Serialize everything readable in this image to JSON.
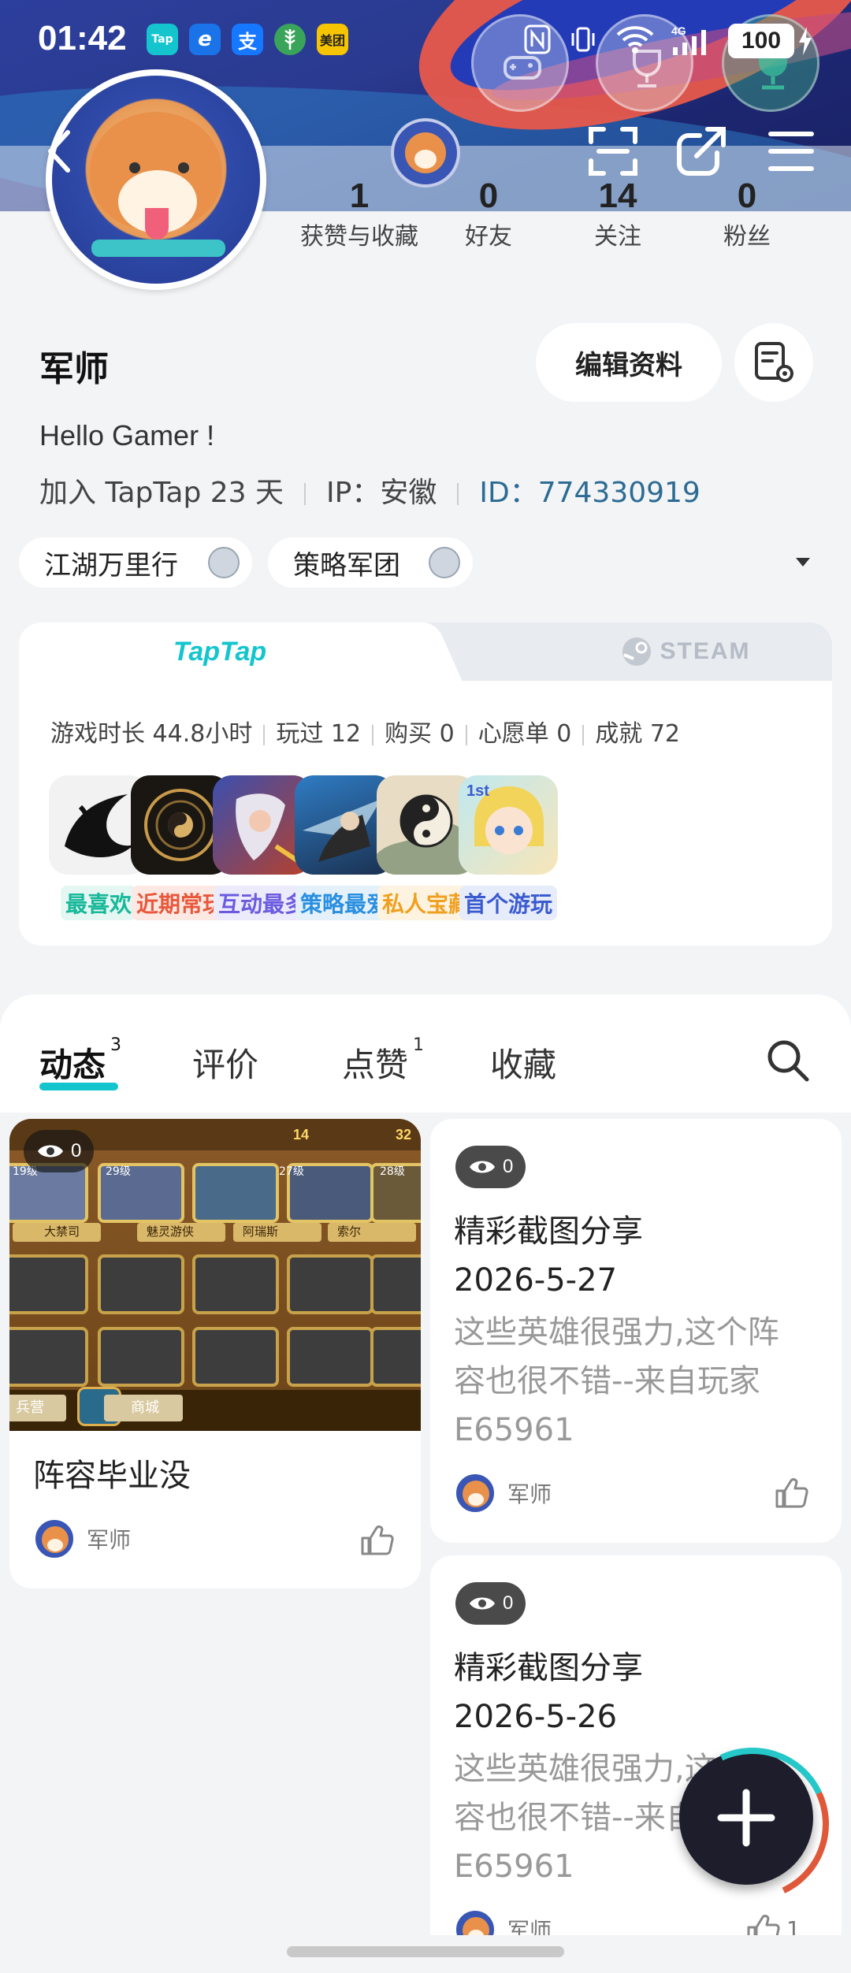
{
  "status_bar": {
    "time": "01:42",
    "apps": [
      {
        "name": "taptap-icon",
        "text": "Tap",
        "color": "#15c5ce"
      },
      {
        "name": "browser-icon",
        "text": "e",
        "color": "#1a73e8"
      },
      {
        "name": "alipay-icon",
        "text": "支",
        "color": "#1677ff"
      },
      {
        "name": "wheat-icon",
        "text": "",
        "color": "#3aa55a"
      },
      {
        "name": "meituan-icon",
        "text": "美团",
        "color": "#f7c400"
      }
    ],
    "battery": "100"
  },
  "profile": {
    "name": "军师",
    "edit_button": "编辑资料",
    "bio": "Hello Gamer !",
    "joined": "加入 TapTap 23 天",
    "ip": "IP：安徽",
    "id": "ID：774330919",
    "stats": [
      {
        "value": "1",
        "label": "获赞与收藏"
      },
      {
        "value": "0",
        "label": "好友"
      },
      {
        "value": "14",
        "label": "关注"
      },
      {
        "value": "0",
        "label": "粉丝"
      }
    ],
    "tags": [
      "江湖万里行",
      "策略军团"
    ]
  },
  "game_card": {
    "tabs": [
      "TapTap",
      "STEAM"
    ],
    "stats": [
      "游戏时长 44.8小时",
      "玩过 12",
      "购买 0",
      "心愿单 0",
      "成就 72"
    ],
    "games": [
      {
        "label": "最喜欢",
        "label_color": "#18b89a",
        "label_bg": "#e4f7f2"
      },
      {
        "label": "近期常玩",
        "label_color": "#e8583c",
        "label_bg": "#fde9e4"
      },
      {
        "label": "互动最多",
        "label_color": "#6b5be0",
        "label_bg": "#ecebfb"
      },
      {
        "label": "策略最爱",
        "label_color": "#2a8fe0",
        "label_bg": "#e4f1fb"
      },
      {
        "label": "私人宝藏",
        "label_color": "#f0a020",
        "label_bg": "#fdf3e0"
      },
      {
        "label": "首个游玩",
        "label_color": "#3a5bd0",
        "label_bg": "#e7ecfb"
      }
    ]
  },
  "feed_tabs": [
    {
      "label": "动态",
      "count": "3"
    },
    {
      "label": "评价",
      "count": ""
    },
    {
      "label": "点赞",
      "count": "1"
    },
    {
      "label": "收藏",
      "count": ""
    }
  ],
  "posts": [
    {
      "views": "0",
      "title": "阵容毕业没",
      "author": "军师",
      "heroes": [
        "大禁司",
        "魅灵游侠",
        "阿瑞斯",
        "索尔"
      ],
      "levels": [
        "19级",
        "29级",
        "27级",
        "28级"
      ],
      "top_counters": [
        "14",
        "32"
      ],
      "buttons": [
        "兵营",
        "商城"
      ]
    },
    {
      "views": "0",
      "title_line1": "精彩截图分享",
      "title_line2": "2026-5-27",
      "body_line1": "这些英雄很强力,这个阵",
      "body_line2": "容也很不错--来自玩家",
      "body_line3": "E65961",
      "author": "军师"
    },
    {
      "views": "0",
      "title_line1": "精彩截图分享",
      "title_line2": "2026-5-26",
      "body_line1": "这些英雄很强力,这个阵",
      "body_line2": "容也很不错--来自玩家",
      "body_line3": "E65961",
      "author": "军师",
      "likes": "1"
    }
  ]
}
